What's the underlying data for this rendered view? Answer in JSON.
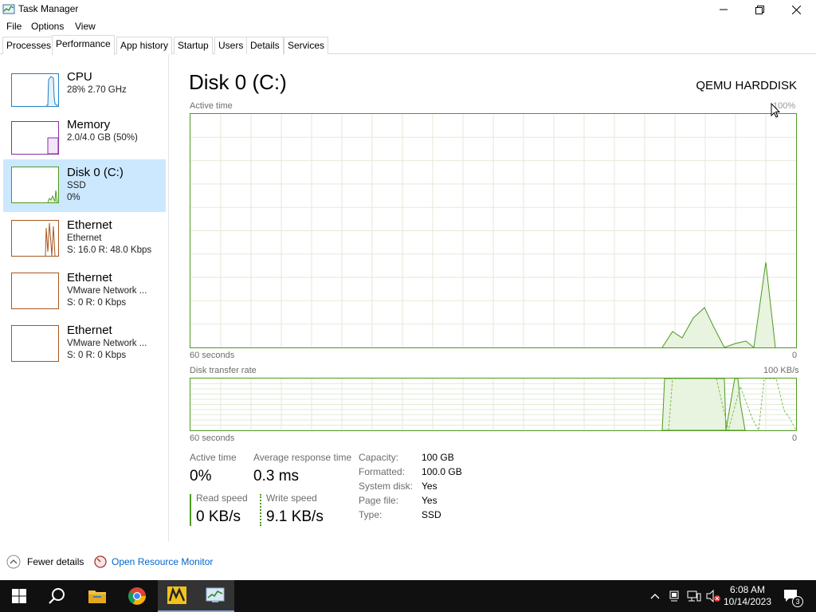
{
  "window": {
    "title": "Task Manager",
    "menu": [
      "File",
      "Options",
      "View"
    ],
    "tabs": [
      "Processes",
      "Performance",
      "App history",
      "Startup",
      "Users",
      "Details",
      "Services"
    ],
    "active_tab": "Performance"
  },
  "sidebar": {
    "items": [
      {
        "title": "CPU",
        "sub1": "28%  2.70 GHz",
        "sub2": "",
        "color": "#1f7ec7"
      },
      {
        "title": "Memory",
        "sub1": "2.0/4.0 GB (50%)",
        "sub2": "",
        "color": "#8b2ca5"
      },
      {
        "title": "Disk 0 (C:)",
        "sub1": "SSD",
        "sub2": "0%",
        "color": "#4d9a1f"
      },
      {
        "title": "Ethernet",
        "sub1": "Ethernet",
        "sub2": "S: 16.0  R: 48.0 Kbps",
        "color": "#a8561e"
      },
      {
        "title": "Ethernet",
        "sub1": "VMware Network ...",
        "sub2": "S: 0  R: 0 Kbps",
        "color": "#a8561e"
      },
      {
        "title": "Ethernet",
        "sub1": "VMware Network ...",
        "sub2": "S: 0  R: 0 Kbps",
        "color": "#a8561e"
      }
    ],
    "selected_index": 2
  },
  "main": {
    "title": "Disk 0 (C:)",
    "device": "QEMU HARDDISK",
    "graph1": {
      "label": "Active time",
      "max": "100%",
      "time": "60 seconds",
      "min": "0"
    },
    "graph2": {
      "label": "Disk transfer rate",
      "max": "100 KB/s",
      "time": "60 seconds",
      "min": "0"
    },
    "stats": {
      "active_time_label": "Active time",
      "active_time_value": "0%",
      "resp_label": "Average response time",
      "resp_value": "0.3 ms",
      "read_label": "Read speed",
      "read_value": "0 KB/s",
      "write_label": "Write speed",
      "write_value": "9.1 KB/s"
    },
    "props": [
      {
        "label": "Capacity:",
        "value": "100 GB"
      },
      {
        "label": "Formatted:",
        "value": "100.0 GB"
      },
      {
        "label": "System disk:",
        "value": "Yes"
      },
      {
        "label": "Page file:",
        "value": "Yes"
      },
      {
        "label": "Type:",
        "value": "SSD"
      }
    ]
  },
  "footer": {
    "fewer_details": "Fewer details",
    "open_resource_monitor": "Open Resource Monitor"
  },
  "taskbar": {
    "time": "6:08 AM",
    "date": "10/14/2023",
    "notification_count": "3"
  },
  "colors": {
    "disk_green": "#4d9a1f",
    "selection": "#cce8ff",
    "link": "#0066cc"
  }
}
